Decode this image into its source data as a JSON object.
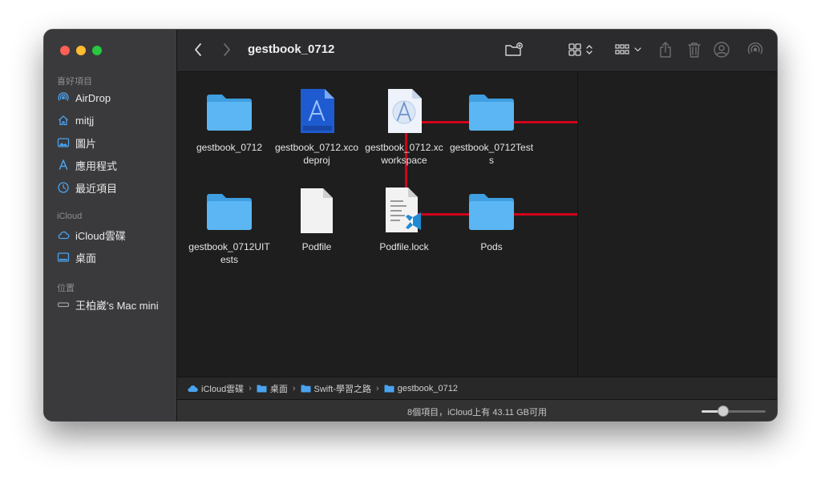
{
  "window": {
    "title": "gestbook_0712"
  },
  "sidebar": {
    "favorites_header": "喜好項目",
    "favorites": [
      {
        "label": "AirDrop",
        "icon": "airdrop-icon"
      },
      {
        "label": "mitjj",
        "icon": "home-icon"
      },
      {
        "label": "圖片",
        "icon": "photos-icon"
      },
      {
        "label": "應用程式",
        "icon": "applications-icon"
      },
      {
        "label": "最近項目",
        "icon": "recents-icon"
      }
    ],
    "icloud_header": "iCloud",
    "icloud": [
      {
        "label": "iCloud雲碟",
        "icon": "cloud-icon"
      },
      {
        "label": "桌面",
        "icon": "desktop-icon"
      }
    ],
    "locations_header": "位置",
    "locations": [
      {
        "label": "王柏崴's Mac mini",
        "icon": "computer-icon"
      }
    ]
  },
  "files": [
    {
      "name": "gestbook_0712",
      "kind": "folder"
    },
    {
      "name": "gestbook_0712.xcodeproj",
      "kind": "xcodeproj"
    },
    {
      "name": "gestbook_0712.xcworkspace",
      "kind": "xcworkspace"
    },
    {
      "name": "gestbook_0712Tests",
      "kind": "folder"
    },
    {
      "name": "gestbook_0712UITests",
      "kind": "folder"
    },
    {
      "name": "Podfile",
      "kind": "document"
    },
    {
      "name": "Podfile.lock",
      "kind": "vscode-document"
    },
    {
      "name": "Pods",
      "kind": "folder"
    }
  ],
  "pathbar": [
    {
      "label": "iCloud雲碟",
      "icon": "cloud-icon"
    },
    {
      "label": "桌面",
      "icon": "folder-icon"
    },
    {
      "label": "Swift-學習之路",
      "icon": "folder-icon"
    },
    {
      "label": "gestbook_0712",
      "icon": "folder-icon"
    }
  ],
  "status": {
    "text": "8個項目，iCloud上有 43.11 GB可用",
    "icon_size": 0.3
  },
  "colors": {
    "folder": "#56b4f0",
    "highlight": "#d0021b",
    "accent": "#4aa3f0"
  }
}
